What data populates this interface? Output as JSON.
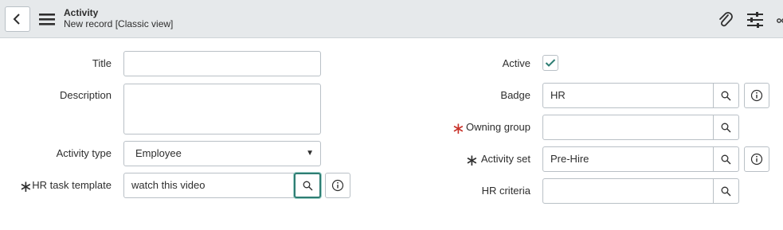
{
  "header": {
    "title": "Activity",
    "subtitle": "New record [Classic view]",
    "icons": [
      "back-icon",
      "hamburger-menu-icon",
      "paperclip-icon",
      "sliders-icon",
      "more-icon"
    ]
  },
  "left": {
    "title_label": "Title",
    "title_value": "",
    "description_label": "Description",
    "description_value": "",
    "activity_type_label": "Activity type",
    "activity_type_value": "Employee",
    "hr_task_template_label": "HR task template",
    "hr_task_template_value": "watch this video"
  },
  "right": {
    "active_label": "Active",
    "active_checked": true,
    "badge_label": "Badge",
    "badge_value": "HR",
    "owning_group_label": "Owning group",
    "owning_group_value": "",
    "activity_set_label": "Activity set",
    "activity_set_value": "Pre-Hire",
    "hr_criteria_label": "HR criteria",
    "hr_criteria_value": ""
  },
  "colors": {
    "header_bg": "#e6e9eb",
    "required_mandatory": "#c8322a",
    "focus": "#2e7d73",
    "check": "#2e7d73"
  }
}
